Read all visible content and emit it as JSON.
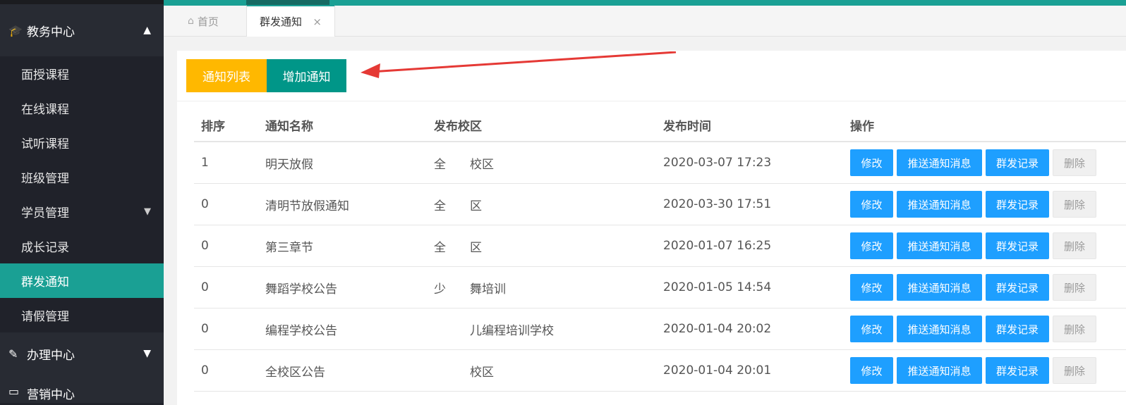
{
  "sidebar": {
    "section_top": {
      "label": "教务中心",
      "icon": "graduation-cap-icon"
    },
    "items": [
      {
        "label": "面授课程"
      },
      {
        "label": "在线课程"
      },
      {
        "label": "试听课程"
      },
      {
        "label": "班级管理"
      },
      {
        "label": "学员管理",
        "has_submenu": true
      },
      {
        "label": "成长记录"
      },
      {
        "label": "群发通知",
        "active": true
      },
      {
        "label": "请假管理"
      }
    ],
    "section_mid": {
      "label": "办理中心",
      "icon": "edit-icon"
    },
    "section_bottom": {
      "label": "营销中心"
    }
  },
  "tabs": {
    "home": "首页",
    "current": "群发通知"
  },
  "toolbar": {
    "list_label": "通知列表",
    "add_label": "增加通知"
  },
  "table": {
    "headers": [
      "排序",
      "通知名称",
      "发布校区",
      "发布时间",
      "操作"
    ],
    "rows": [
      {
        "order": "1",
        "name": "明天放假",
        "campus": "全　　校区",
        "time": "2020-03-07 17:23"
      },
      {
        "order": "0",
        "name": "清明节放假通知",
        "campus": "全　　区",
        "time": "2020-03-30 17:51"
      },
      {
        "order": "0",
        "name": "第三章节",
        "campus": "全　　区",
        "time": "2020-01-07 16:25"
      },
      {
        "order": "0",
        "name": "舞蹈学校公告",
        "campus": "少　　舞培训",
        "time": "2020-01-05 14:54"
      },
      {
        "order": "0",
        "name": "编程学校公告",
        "campus": "　　　儿编程培训学校",
        "time": "2020-01-04 20:02"
      },
      {
        "order": "0",
        "name": "全校区公告",
        "campus": "　　　校区",
        "time": "2020-01-04 20:01"
      }
    ],
    "actions": {
      "edit": "修改",
      "push": "推送通知消息",
      "log": "群发记录",
      "delete": "删除"
    }
  },
  "colors": {
    "accent": "#1aa094",
    "yellow": "#ffb800",
    "teal": "#009688",
    "blue": "#1e9fff",
    "arrow": "#e53935"
  }
}
